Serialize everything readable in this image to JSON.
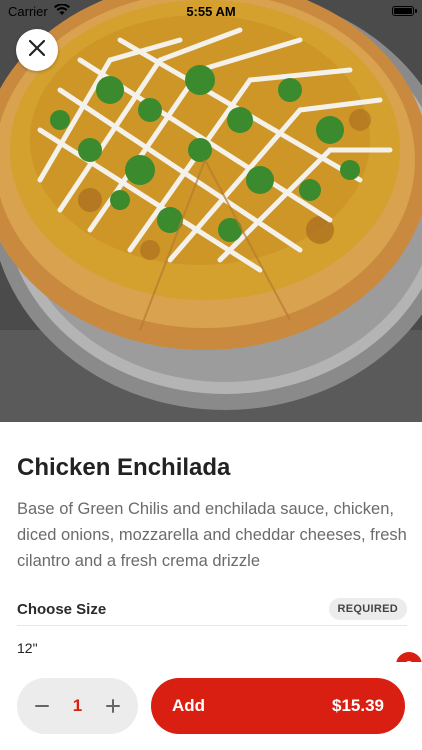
{
  "status_bar": {
    "carrier": "Carrier",
    "time": "5:55 AM",
    "wifi_icon": "wifi-icon",
    "battery_icon": "battery-icon"
  },
  "hero": {
    "image": "pizza-photo",
    "close_icon": "close-icon"
  },
  "product": {
    "name": "Chicken Enchilada",
    "description": "Base of Green Chilis and enchilada sauce, chicken, diced onions, mozzarella and cheddar cheeses, fresh cilantro and a fresh crema drizzle"
  },
  "size_section": {
    "title": "Choose Size",
    "badge": "REQUIRED",
    "options": [
      {
        "label": "12\"",
        "selected": true
      }
    ]
  },
  "cart": {
    "quantity": "1",
    "minus_icon": "minus-icon",
    "plus_icon": "plus-icon",
    "add_label": "Add",
    "price": "$15.39"
  },
  "colors": {
    "accent": "#d81f12",
    "badge_bg": "#ececec",
    "muted_text": "#6b6b6b"
  }
}
